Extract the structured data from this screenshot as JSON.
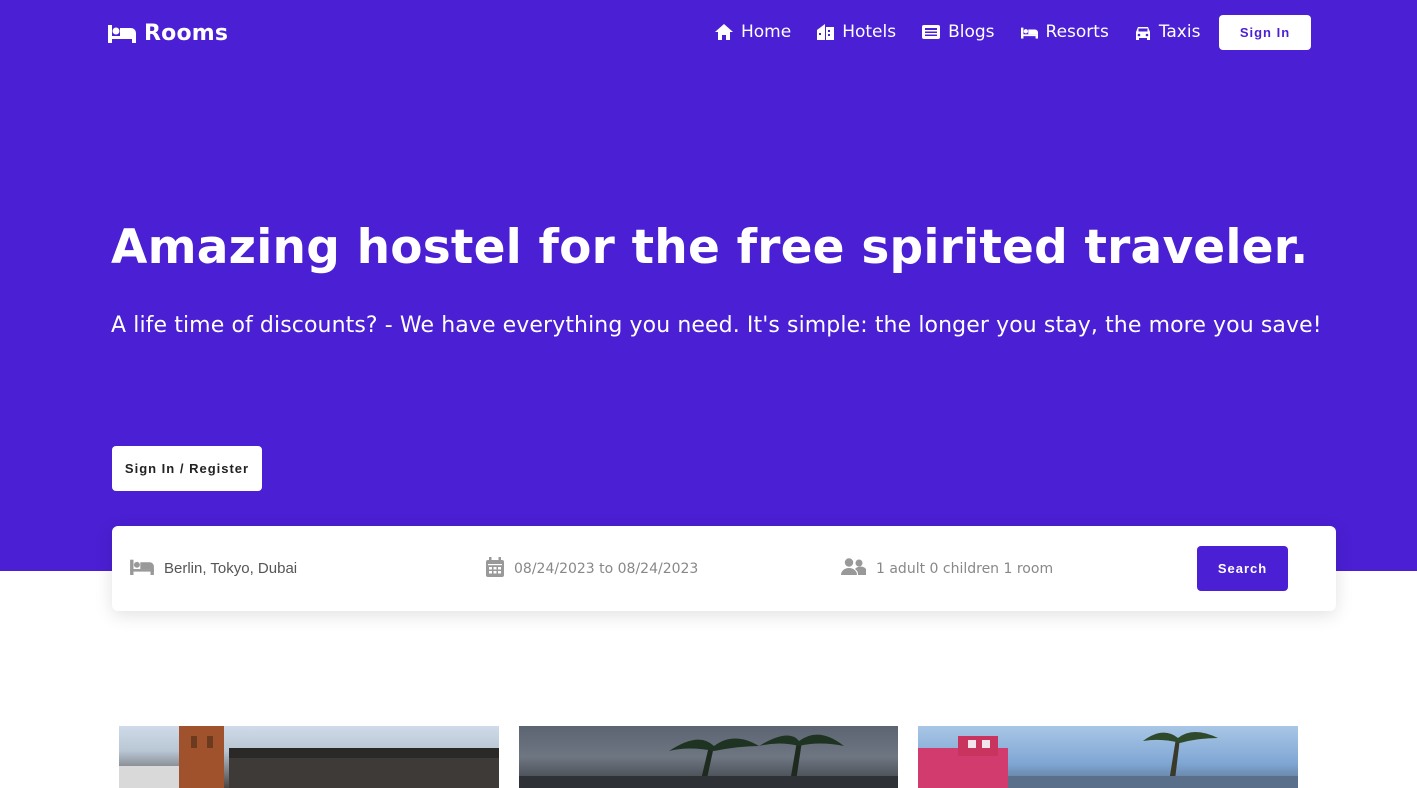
{
  "brand": {
    "name": "Rooms",
    "icon": "bed-icon"
  },
  "nav": {
    "items": [
      {
        "label": "Home",
        "icon": "home-icon"
      },
      {
        "label": "Hotels",
        "icon": "hotel-icon"
      },
      {
        "label": "Blogs",
        "icon": "newspaper-icon"
      },
      {
        "label": "Resorts",
        "icon": "bed-icon"
      },
      {
        "label": "Taxis",
        "icon": "taxi-icon"
      }
    ],
    "signin_label": "Sign In"
  },
  "hero": {
    "headline": "Amazing hostel for the free spirited traveler.",
    "subhead": "A life time of discounts? - We have everything you need. It's simple: the longer you stay, the more you save!",
    "register_label": "Sign In / Register"
  },
  "search": {
    "destination_placeholder": "Berlin, Tokyo, Dubai",
    "dates_value": "08/24/2023 to 08/24/2023",
    "guests_value": "1 adult 0 children 1 room",
    "button_label": "Search"
  },
  "colors": {
    "primary": "#4b1fd3",
    "white": "#ffffff"
  },
  "cards": [
    {
      "icon": "hotel-photo"
    },
    {
      "icon": "resort-photo"
    },
    {
      "icon": "palm-hotel-photo"
    }
  ]
}
